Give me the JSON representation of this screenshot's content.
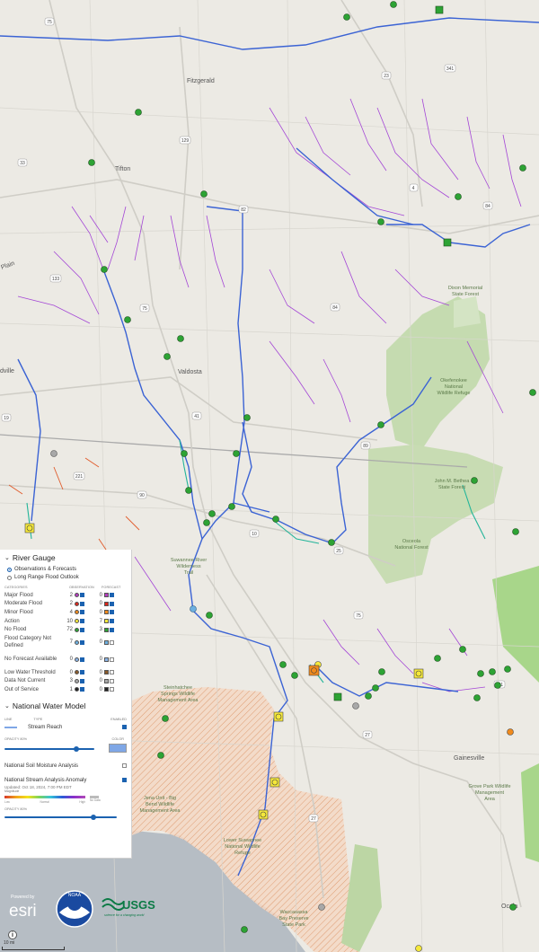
{
  "map": {
    "towns": [
      "Fitzgerald",
      "Tifton",
      "Valdosta",
      "Gainesville",
      "Ocala",
      "dville",
      "Plain"
    ],
    "areas": {
      "dixon": [
        "Dixon Memorial",
        "State Forest"
      ],
      "okefenokee": [
        "Okefenokee",
        "National",
        "Wildlife Refuge"
      ],
      "bethea": [
        "John M. Bethea",
        "State Forest"
      ],
      "osceola": [
        "Osceola",
        "National Forest"
      ],
      "suwannee_trail": [
        "Suwannee River",
        "Wilderness",
        "Trail"
      ],
      "steinhatchee": [
        "Steinhatchee",
        "Springs Wildlife",
        "Management Area"
      ],
      "bigbend": [
        "Jena Unit - Big",
        "Bend Wildlife",
        "Management Area"
      ],
      "lower_suwannee": [
        "Lower Suwannee",
        "National Wildlife",
        "Refuge"
      ],
      "grove_park": [
        "Grove Park Wildlife",
        "Management",
        "Area"
      ],
      "waccasassa": [
        "Waccasassa",
        "Bay Preserve",
        "State Park"
      ]
    },
    "shields": [
      "75",
      "23",
      "129",
      "33",
      "341",
      "4",
      "84",
      "82",
      "133",
      "75",
      "84",
      "41",
      "19",
      "89",
      "221",
      "90",
      "10",
      "25",
      "75",
      "27",
      "27",
      "301"
    ]
  },
  "legend": {
    "river_gauge": {
      "title": "River Gauge",
      "options": [
        "Observations & Forecasts",
        "Long Range Flood Outlook"
      ],
      "col_categories": "CATEGORIES",
      "col_observation": "OBSERVATION",
      "col_forecast": "FORECAST",
      "categories": [
        {
          "name": "Major Flood",
          "obs": "2",
          "obs_color": "#b43dbf",
          "fc": "0",
          "fc_color": "#b43dbf"
        },
        {
          "name": "Moderate Flood",
          "obs": "2",
          "obs_color": "#d9261c",
          "fc": "0",
          "fc_color": "#d9261c"
        },
        {
          "name": "Minor Flood",
          "obs": "4",
          "obs_color": "#f08a1c",
          "fc": "0",
          "fc_color": "#f08a1c"
        },
        {
          "name": "Action",
          "obs": "10",
          "obs_color": "#f5e83a",
          "fc": "7",
          "fc_color": "#f5e83a"
        },
        {
          "name": "No Flood",
          "obs": "72",
          "obs_color": "#2da334",
          "fc": "3",
          "fc_color": "#2da334"
        },
        {
          "name": "Flood Category Not Defined",
          "obs": "7",
          "obs_color": "#6db0e0",
          "fc": "0",
          "fc_color": "#6db0e0"
        },
        {
          "name": "No Forecast Available",
          "obs": "0",
          "obs_color": "#8ab4e8",
          "fc": "0",
          "fc_color": "#8ab4e8"
        },
        {
          "name": "Low Water Threshold",
          "obs": "0",
          "obs_color": "#8a5a2b",
          "fc": "0",
          "fc_color": "#8a5a2b"
        },
        {
          "name": "Data Not Current",
          "obs": "3",
          "obs_color": "#a8a8a8",
          "fc": "0",
          "fc_color": "#a8a8a8"
        },
        {
          "name": "Out of Service",
          "obs": "1",
          "obs_color": "#222222",
          "fc": "0",
          "fc_color": "#222222"
        }
      ]
    },
    "nwm": {
      "title": "National Water Model",
      "col_line": "LINE",
      "col_type": "TYPE",
      "col_enabled": "ENABLED",
      "stream_reach": "Stream Reach",
      "opacity_label": "OPACITY 80%",
      "color_label": "COLOR",
      "opacity": 0.8,
      "soil": "National Soil Moisture Analysis",
      "stream_anomaly": "National Stream Analysis Anomaly",
      "updated": "Updated: Oct 18, 2024, 7:00 PM EDT",
      "magnitude": "Magnitude",
      "grad_low": "Low",
      "grad_normal": "Normal",
      "grad_high": "High",
      "grad_nodata": "No Data",
      "opacity2_label": "OPACITY 80%",
      "opacity2": 0.8
    }
  },
  "logos": {
    "esri": "esri",
    "esri_small": "Powered by",
    "noaa": "NOAA",
    "usgs": "USGS",
    "usgs_tag": "science for a changing world"
  },
  "scale": {
    "label": "10 mi"
  },
  "info": "i",
  "colors": {
    "accent": "#1b62b0",
    "gulf": "#b6bdc4",
    "forest": "#c5dbb0",
    "wma_hatch": "#e8a87c"
  }
}
